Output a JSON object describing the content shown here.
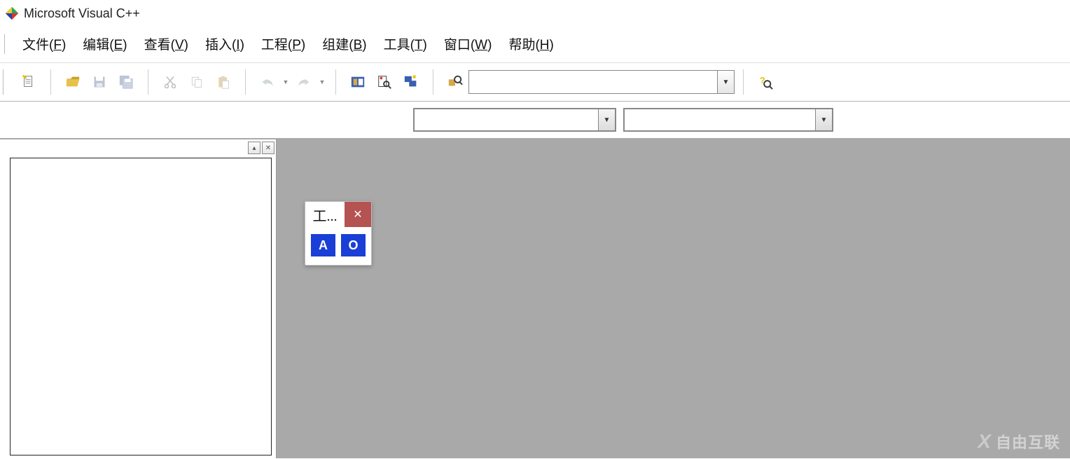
{
  "title": "Microsoft Visual C++",
  "menu": {
    "file": "文件(F)",
    "edit": "编辑(E)",
    "view": "查看(V)",
    "insert": "插入(I)",
    "project": "工程(P)",
    "build": "组建(B)",
    "tools": "工具(T)",
    "window": "窗口(W)",
    "help": "帮助(H)"
  },
  "toolbar": {
    "search_value": "",
    "combo1_value": "",
    "combo2_value": ""
  },
  "float": {
    "title": "工...",
    "cell_a": "A",
    "cell_o": "O"
  },
  "watermark": "自由互联"
}
